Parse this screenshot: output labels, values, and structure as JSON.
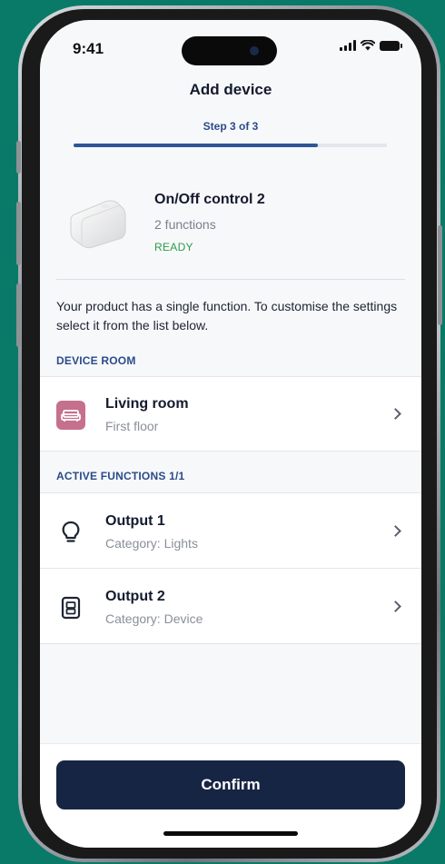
{
  "status_bar": {
    "time": "9:41"
  },
  "header": {
    "title": "Add device",
    "step": "Step 3 of 3",
    "progress": 0.78
  },
  "device": {
    "name": "On/Off control 2",
    "functions": "2 functions",
    "status": "READY"
  },
  "description": "Your product has a single function. To customise the settings select it from the list below.",
  "room_section": {
    "label": "DEVICE ROOM",
    "room": {
      "name": "Living room",
      "floor": "First floor",
      "icon": "sofa-icon",
      "icon_color": "#c5708c"
    }
  },
  "functions_section": {
    "label": "ACTIVE FUNCTIONS 1/1",
    "items": [
      {
        "title": "Output 1",
        "category": "Category: Lights",
        "icon": "lightbulb-icon"
      },
      {
        "title": "Output 2",
        "category": "Category: Device",
        "icon": "device-icon"
      }
    ]
  },
  "footer": {
    "confirm_label": "Confirm"
  },
  "colors": {
    "accent": "#2f5597",
    "button": "#172544",
    "ready": "#2a9d4a",
    "background": "#0a7a68"
  }
}
